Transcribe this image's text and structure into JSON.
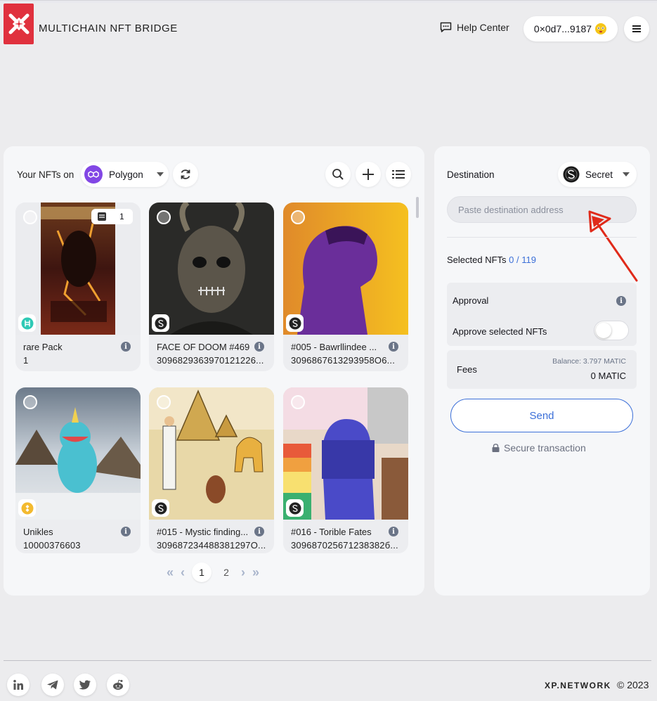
{
  "header": {
    "brand": "MULTICHAIN NFT BRIDGE",
    "help_label": "Help Center",
    "wallet_address": "0×0d7...9187"
  },
  "nft_panel": {
    "label": "Your NFTs on",
    "chain": "Polygon",
    "cards": [
      {
        "name": "rare Pack",
        "id": "1",
        "count": "1",
        "chain_icon": "hedera-icon"
      },
      {
        "name": "FACE OF DOOM #469",
        "id": "3096829363970121226...",
        "chain_icon": "secret-icon"
      },
      {
        "name": "#005 - Bawrllindee ...",
        "id": "3096867613293958O6...",
        "chain_icon": "secret-icon"
      },
      {
        "name": "Unikles",
        "id": "10000376603",
        "chain_icon": "bnb-icon"
      },
      {
        "name": "#015 - Mystic finding...",
        "id": "309687234488381297O...",
        "chain_icon": "secret-icon"
      },
      {
        "name": "#016 - Torible Fates",
        "id": "309687025671238382б...",
        "chain_icon": "secret-icon"
      }
    ],
    "pagination": {
      "pages": [
        "1",
        "2"
      ],
      "current": "1"
    }
  },
  "destination_panel": {
    "label": "Destination",
    "chain": "Secret",
    "address_placeholder": "Paste destination address",
    "selected_label": "Selected NFTs",
    "selected_count": "0 / 119",
    "approval_title": "Approval",
    "approve_label": "Approve selected NFTs",
    "approve_enabled": false,
    "fees_label": "Fees",
    "balance": "Balance: 3.797 MATIC",
    "fee_value": "0 MATIC",
    "send_label": "Send",
    "secure_label": "Secure transaction",
    "annotation_color": "#e02a1a"
  },
  "footer": {
    "social": [
      "linkedin-icon",
      "telegram-icon",
      "twitter-icon",
      "reddit-icon"
    ],
    "company": "XP.NETWORK",
    "copyright": "© 2023"
  }
}
